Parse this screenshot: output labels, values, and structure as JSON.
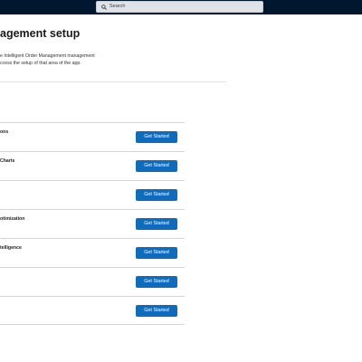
{
  "topbar": {
    "search_placeholder": "Search"
  },
  "page": {
    "title": "agement setup",
    "description_line1": "e Intelligent Order Management  management",
    "description_line2": "ccess the setup of that area of the app."
  },
  "rows": [
    {
      "label": "ons",
      "button": "Get Started"
    },
    {
      "label": "Charts",
      "button": "Get Started"
    },
    {
      "label": "",
      "button": "Get Started"
    },
    {
      "label": "otimization",
      "button": "Get Started"
    },
    {
      "label": "telligence",
      "button": "Get Started"
    },
    {
      "label": "",
      "button": "Get Started"
    },
    {
      "label": "",
      "button": "Get Started"
    }
  ],
  "colors": {
    "topbar": "#00182f",
    "primary_button": "#0f6cbd"
  },
  "icons": {
    "search": "search-icon"
  }
}
